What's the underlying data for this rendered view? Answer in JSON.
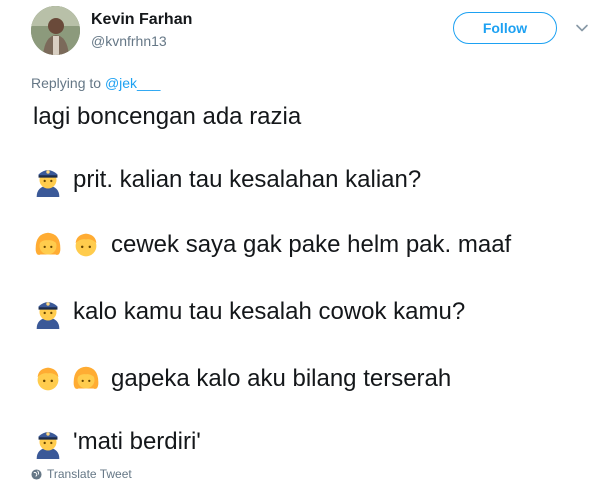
{
  "author": {
    "name": "Kevin Farhan",
    "handle": "@kvnfrhn13",
    "avatar_icon": "profile-photo"
  },
  "follow_label": "Follow",
  "menu_icon": "chevron-down-icon",
  "reply": {
    "prefix": "Replying to",
    "mention": "@jek___"
  },
  "lines": [
    {
      "emojis": [],
      "text": "lagi boncengan ada razia"
    },
    {
      "emojis": [
        "police-officer-emoji"
      ],
      "text": "prit. kalian tau kesalahan kalian?"
    },
    {
      "emojis": [
        "girl-emoji",
        "boy-emoji"
      ],
      "text": "cewek saya gak pake helm pak. maaf"
    },
    {
      "emojis": [
        "police-officer-emoji"
      ],
      "text": "kalo kamu tau kesalah cowok kamu?"
    },
    {
      "emojis": [
        "boy-emoji",
        "girl-emoji"
      ],
      "text": "gapeka kalo aku bilang terserah"
    },
    {
      "emojis": [
        "police-officer-emoji"
      ],
      "text": "'mati berdiri'"
    }
  ],
  "translate_label": "Translate Tweet",
  "colors": {
    "accent": "#1da1f2",
    "secondary_text": "#657786",
    "primary_text": "#14171a"
  }
}
